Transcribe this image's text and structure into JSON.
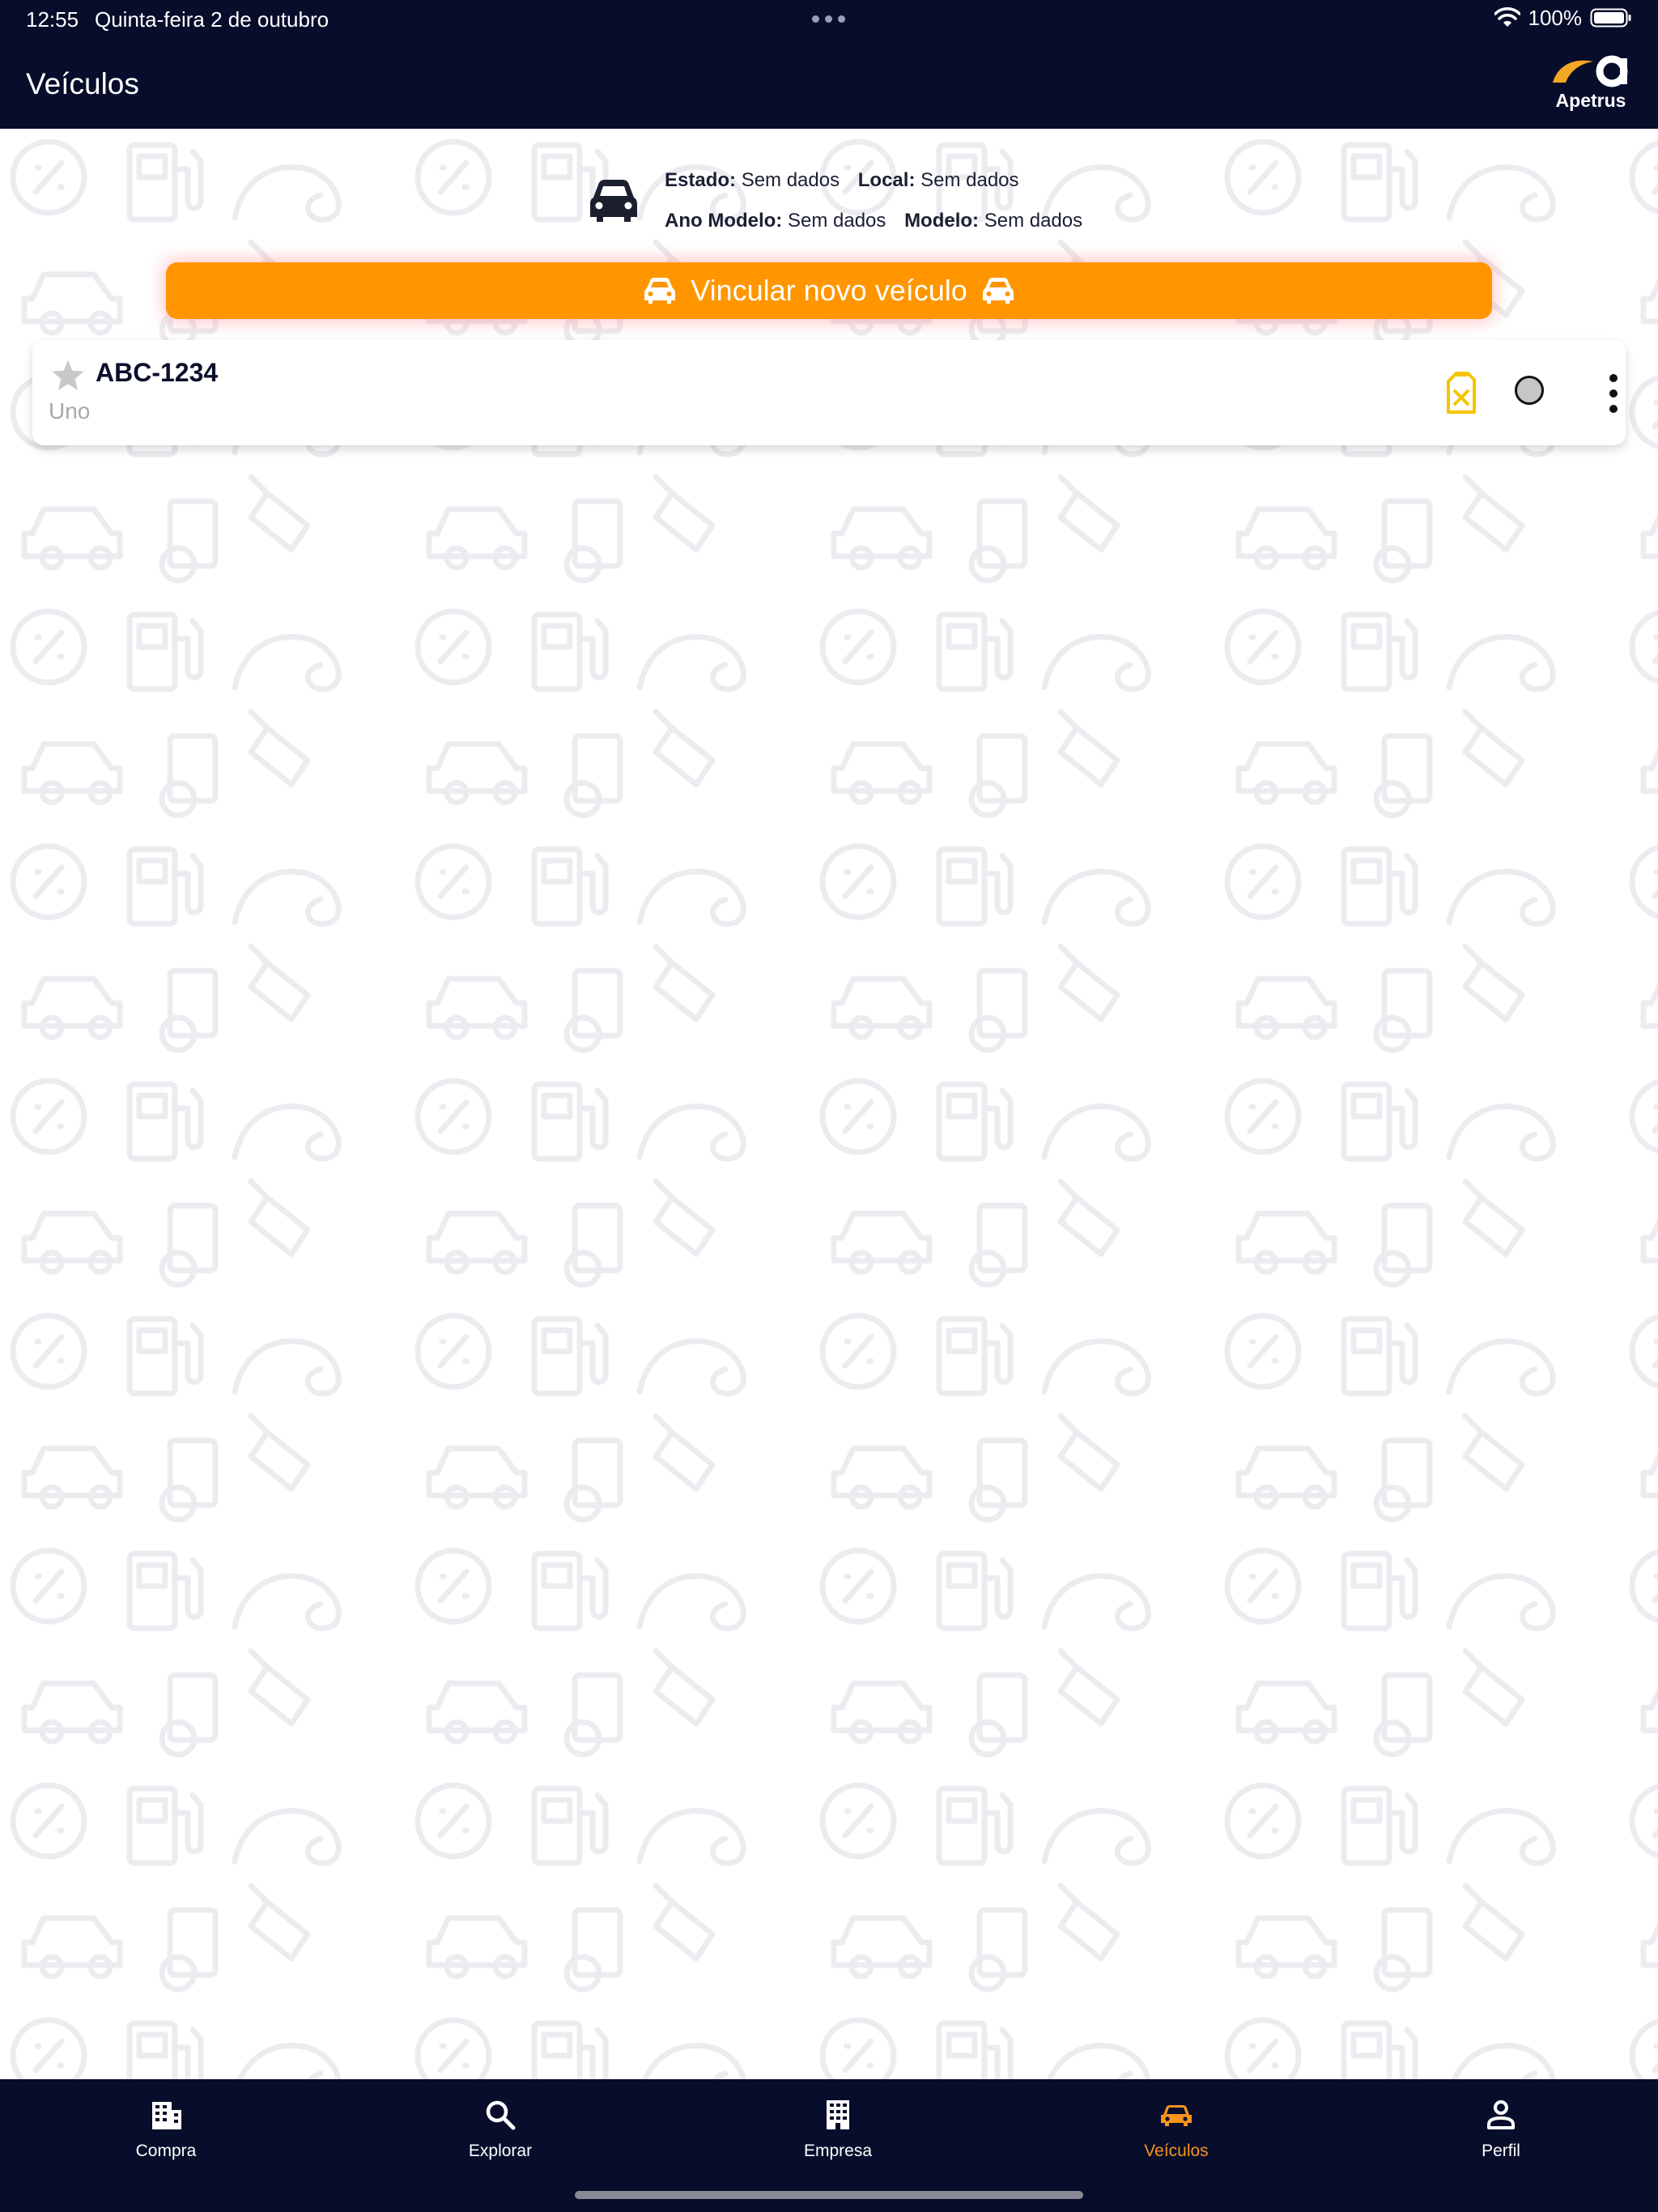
{
  "status_bar": {
    "time": "12:55",
    "date": "Quinta-feira 2 de outubro",
    "battery": "100%"
  },
  "header": {
    "title": "Veículos",
    "logo_text": "Apetrus"
  },
  "vehicle_info": {
    "state_label": "Estado:",
    "state_value": "Sem dados",
    "location_label": "Local:",
    "location_value": "Sem dados",
    "model_year_label": "Ano Modelo:",
    "model_year_value": "Sem dados",
    "model_label": "Modelo:",
    "model_value": "Sem dados"
  },
  "link_button": {
    "label": "Vincular novo veículo"
  },
  "vehicles": [
    {
      "plate": "ABC-1234",
      "model": "Uno",
      "favorite": false
    }
  ],
  "tabs": [
    {
      "label": "Compra",
      "icon": "building-icon"
    },
    {
      "label": "Explorar",
      "icon": "search-icon"
    },
    {
      "label": "Empresa",
      "icon": "office-building-icon"
    },
    {
      "label": "Veículos",
      "icon": "car-icon",
      "active": true
    },
    {
      "label": "Perfil",
      "icon": "person-icon"
    }
  ],
  "colors": {
    "header_bg": "#070d2b",
    "accent": "#ff9600",
    "active_tab": "#f7941d",
    "fuel_icon": "#f5c400",
    "pattern": "#ececf0"
  }
}
